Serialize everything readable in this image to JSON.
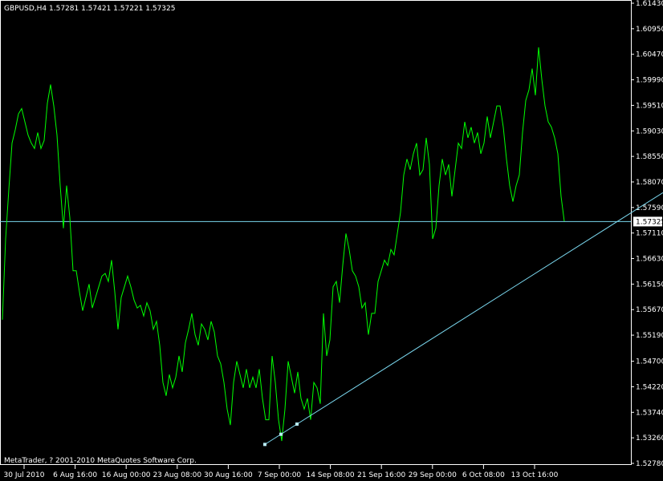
{
  "header": {
    "title": "GBPUSD,H4  1.57281 1.57421 1.57221 1.57325"
  },
  "footer": {
    "copyright": "MetaTrader, ? 2001-2010 MetaQuotes Software Corp."
  },
  "colors": {
    "background": "#000000",
    "price_line": "#00ff00",
    "trend_line": "#7ad7ee",
    "bid_line": "#7ad7ee",
    "frame": "#ffffff"
  },
  "chart_data": {
    "type": "line",
    "symbol": "GBPUSD",
    "timeframe": "H4",
    "current_price": "1.57325",
    "ylim": [
      1.5278,
      1.6143
    ],
    "y_ticks": [
      "1.61430",
      "1.60950",
      "1.60470",
      "1.59990",
      "1.59510",
      "1.59030",
      "1.58550",
      "1.58070",
      "1.57590",
      "1.57110",
      "1.56630",
      "1.56150",
      "1.55670",
      "1.55190",
      "1.54700",
      "1.54220",
      "1.53740",
      "1.53260",
      "1.52780"
    ],
    "x_ticks": [
      "30 Jul 2010",
      "6 Aug 16:00",
      "16 Aug 00:00",
      "23 Aug 08:00",
      "30 Aug 16:00",
      "7 Sep 00:00",
      "14 Sep 08:00",
      "21 Sep 16:00",
      "29 Sep 00:00",
      "6 Oct 08:00",
      "13 Oct 16:00"
    ],
    "grid": false,
    "x_index": [
      0,
      4,
      8,
      12,
      16,
      20,
      24,
      28,
      32,
      36,
      40,
      44,
      48,
      52,
      56,
      60,
      64,
      68,
      72,
      76,
      80,
      84,
      88,
      92,
      96,
      100,
      104,
      108,
      112,
      116,
      120,
      124,
      128,
      132,
      136,
      140,
      144,
      148,
      152,
      156,
      160,
      164,
      168,
      172,
      176,
      180,
      184,
      188,
      192,
      196,
      200,
      204,
      208,
      212,
      216,
      220,
      224,
      228,
      232,
      236,
      240,
      244,
      248,
      252,
      256,
      260,
      264,
      268,
      272,
      276,
      280,
      284,
      288,
      292,
      296,
      300,
      304,
      308,
      312,
      316,
      320,
      324,
      328,
      332,
      336,
      340,
      344,
      348,
      352,
      356,
      360,
      364,
      368,
      372,
      376,
      380,
      384,
      388,
      392,
      396,
      400,
      404,
      408,
      412,
      416,
      420,
      424,
      428,
      432,
      436,
      440,
      444,
      448,
      452,
      456,
      460,
      464,
      468,
      472,
      476,
      480,
      484,
      488,
      492,
      496,
      500,
      504,
      508,
      512,
      516,
      520,
      524,
      528,
      532,
      536,
      540,
      544,
      548,
      552,
      556,
      560,
      564,
      568,
      572,
      576,
      580,
      584,
      588,
      592,
      596,
      600,
      604,
      608,
      612,
      616,
      620,
      624,
      628,
      632,
      636,
      640,
      644,
      648,
      652,
      656,
      660,
      664,
      668,
      672,
      676,
      680,
      684,
      688
    ],
    "series": [
      {
        "values": [
          1.5548,
          1.57,
          1.5793,
          1.588,
          1.5905,
          1.5935,
          1.5945,
          1.592,
          1.5895,
          1.588,
          1.587,
          1.59,
          1.587,
          1.5885,
          1.5955,
          1.599,
          1.595,
          1.5895,
          1.58,
          1.572,
          1.58,
          1.574,
          1.564,
          1.564,
          1.56,
          1.5565,
          1.559,
          1.5615,
          1.557,
          1.559,
          1.561,
          1.563,
          1.5635,
          1.562,
          1.566,
          1.56,
          1.553,
          1.559,
          1.561,
          1.563,
          1.561,
          1.5585,
          1.557,
          1.5575,
          1.5555,
          1.558,
          1.5565,
          1.553,
          1.5545,
          1.55,
          1.543,
          1.5405,
          1.5445,
          1.542,
          1.544,
          1.548,
          1.545,
          1.5505,
          1.553,
          1.556,
          1.552,
          1.55,
          1.554,
          1.553,
          1.551,
          1.5545,
          1.5525,
          1.548,
          1.5465,
          1.543,
          1.538,
          1.535,
          1.543,
          1.547,
          1.5445,
          1.542,
          1.5455,
          1.542,
          1.544,
          1.542,
          1.5455,
          1.54,
          1.536,
          1.536,
          1.548,
          1.543,
          1.536,
          1.532,
          1.538,
          1.547,
          1.544,
          1.541,
          1.545,
          1.54,
          1.538,
          1.54,
          1.536,
          1.543,
          1.542,
          1.539,
          1.556,
          1.548,
          1.551,
          1.561,
          1.562,
          1.558,
          1.565,
          1.571,
          1.568,
          1.564,
          1.563,
          1.561,
          1.557,
          1.558,
          1.552,
          1.556,
          1.556,
          1.562,
          1.564,
          1.566,
          1.565,
          1.568,
          1.567,
          1.571,
          1.575,
          1.582,
          1.585,
          1.583,
          1.586,
          1.588,
          1.582,
          1.583,
          1.589,
          1.584,
          1.57,
          1.572,
          1.58,
          1.585,
          1.582,
          1.584,
          1.578,
          1.583,
          1.588,
          1.587,
          1.592,
          1.589,
          1.591,
          1.588,
          1.59,
          1.586,
          1.588,
          1.593,
          1.589,
          1.592,
          1.595,
          1.595,
          1.591,
          1.585,
          1.58,
          1.577,
          1.58,
          1.582,
          1.59,
          1.596,
          1.598,
          1.602,
          1.597,
          1.606,
          1.6,
          1.595,
          1.592,
          1.591,
          1.589,
          1.586,
          1.578,
          1.5733
        ]
      }
    ],
    "trend_line": {
      "start": [
        330,
        1.53136
      ],
      "end": [
        826,
        1.5787
      ]
    },
    "anchor_points": [
      [
        330,
        1.53136
      ],
      [
        350,
        1.53327
      ],
      [
        370,
        1.53518
      ]
    ],
    "bid_level": 1.57325
  }
}
